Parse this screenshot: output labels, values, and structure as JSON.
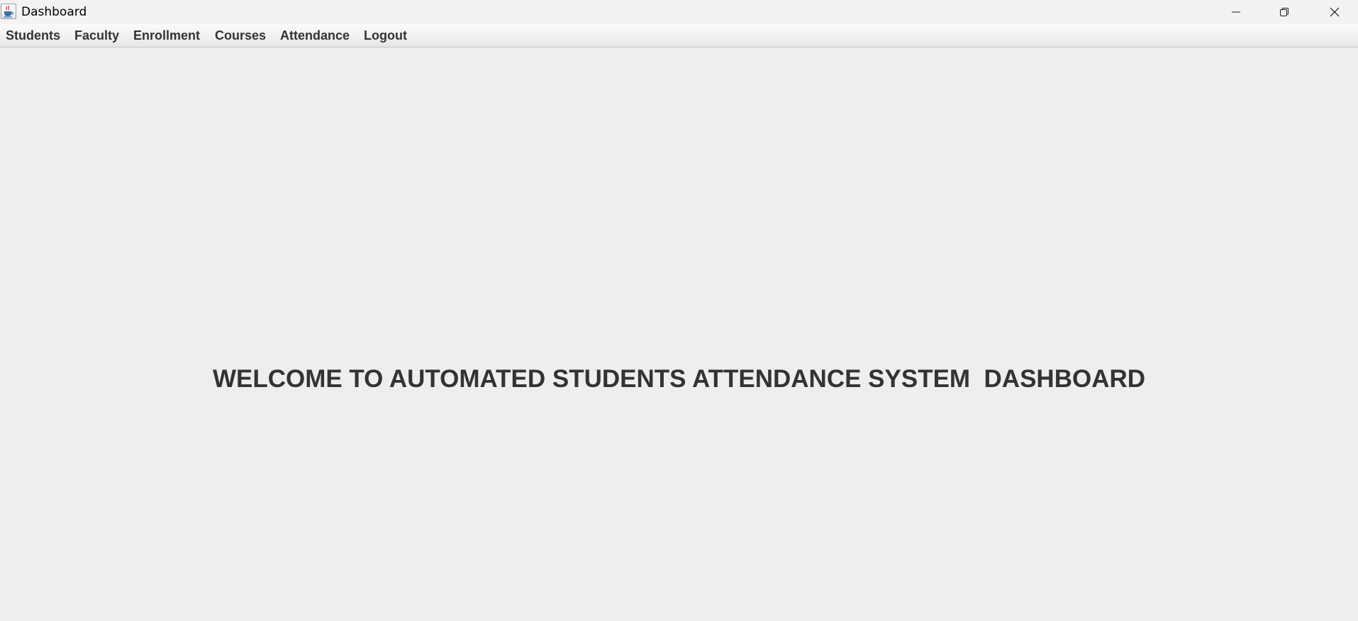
{
  "window": {
    "title": "Dashboard",
    "app_icon": "java-coffee-cup-icon",
    "controls": {
      "minimize_icon": "minimize-icon",
      "maximize_icon": "restore-icon",
      "close_icon": "close-icon"
    }
  },
  "menubar": {
    "items": [
      {
        "label": "Students"
      },
      {
        "label": "Faculty"
      },
      {
        "label": "Enrollment"
      },
      {
        "label": "Courses"
      },
      {
        "label": "Attendance"
      },
      {
        "label": "Logout"
      }
    ]
  },
  "main": {
    "welcome_text": "WELCOME TO AUTOMATED STUDENTS ATTENDANCE SYSTEM  DASHBOARD"
  },
  "colors": {
    "background": "#eeeeee",
    "text": "#333333",
    "titlebar": "#f3f3f3"
  }
}
